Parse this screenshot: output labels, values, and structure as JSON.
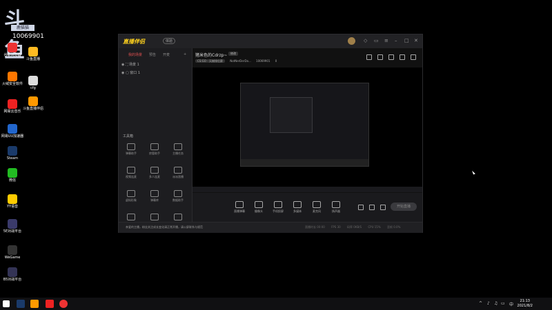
{
  "watermark": {
    "glyph": "斗鱼",
    "label": "鹿猫猫",
    "room": "10069901"
  },
  "desktop_icons": [
    {
      "label": "回收站",
      "color": "#bcd"
    },
    {
      "label": "DJ Studio HUB",
      "color": "#ddd"
    },
    {
      "label": "谷歌浏览器",
      "color": "#e33"
    },
    {
      "label": "斗鱼直播",
      "color": "#fb2"
    },
    {
      "label": "火绒安全软件",
      "color": "#f70"
    },
    {
      "label": "cfg",
      "color": "#ddd"
    },
    {
      "label": "网易云音乐",
      "color": "#e22"
    },
    {
      "label": "斗鱼直播伴侣",
      "color": "#f90"
    },
    {
      "label": "网易UU加速器",
      "color": "#26c"
    },
    {
      "label": "Steam",
      "color": "#1a3a6a"
    },
    {
      "label": "微信",
      "color": "#2b2"
    },
    {
      "label": "YY语音",
      "color": "#fc0"
    },
    {
      "label": "5E对战平台",
      "color": "#3a3a6a"
    },
    {
      "label": "WeGame",
      "color": "#333"
    },
    {
      "label": "B5对战平台",
      "color": "#335"
    }
  ],
  "app": {
    "title": "直播伴侣",
    "version": "体验",
    "left_tabs": [
      "我的场景",
      "预告",
      "开麦"
    ],
    "scenes": [
      "场景 1",
      "窗口 1"
    ],
    "tools_title": "工具箱",
    "tools": [
      "弹幕助手",
      "房管助手",
      "主播任务",
      "视频连麦",
      "多人连麦",
      "派派直播",
      "虚拟形象",
      "弹幕库",
      "数据助手",
      "全民乐玩",
      "人气上报",
      "上车一起玩"
    ],
    "stream_title": "猪米色的Cdrzp~",
    "modify_btn": "修改",
    "category": "CS:GO - 天梯排位赛",
    "streamer": "NotNerDerDo...",
    "room_id": "10069901",
    "hot": "0",
    "bottom_buttons": [
      "直播弹幕",
      "摄像头",
      "手机投屏",
      "多媒体",
      "麦克风",
      "扬声器"
    ],
    "go_live": "开始直播",
    "notice": "亲爱的主播，粉丝关注成长变化请正常开播，请公屏联系与规范",
    "stats": [
      "直播时长 00:00",
      "FPS 30",
      "码率 0KB/S",
      "CPU 15%",
      "丢帧 0.0%"
    ]
  },
  "taskbar": {
    "time": "21:13",
    "date": "2021/8/2",
    "lang": "中"
  }
}
